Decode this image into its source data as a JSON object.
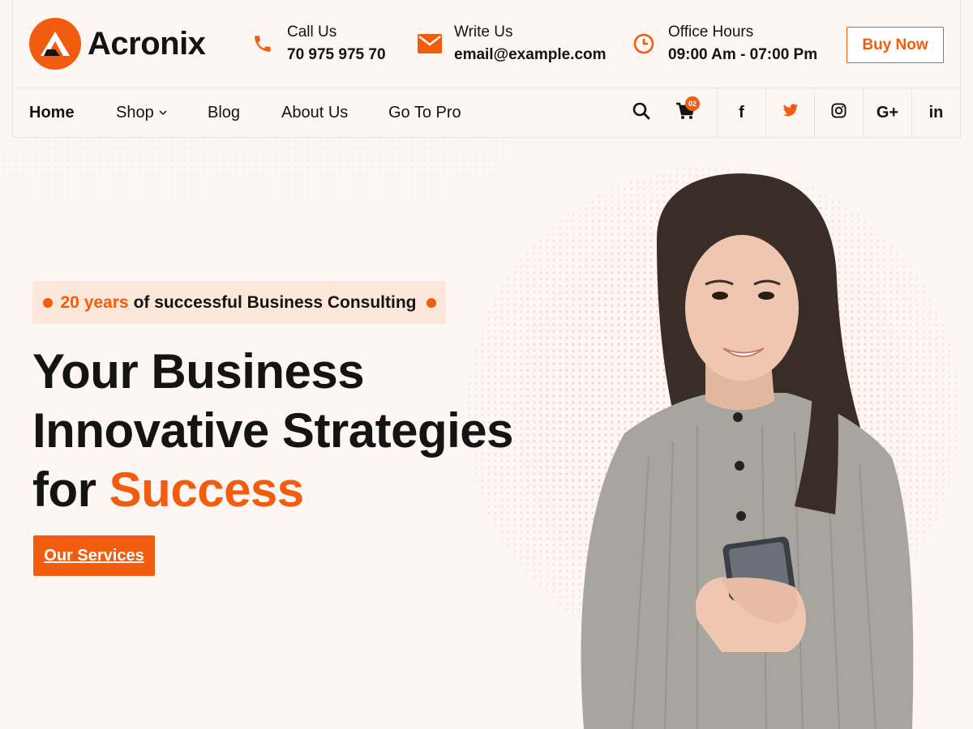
{
  "brand": {
    "name": "Acronix",
    "accent": "#f25c0f"
  },
  "contacts": [
    {
      "icon": "phone-icon",
      "label": "Call Us",
      "value": "70 975 975 70"
    },
    {
      "icon": "envelope-icon",
      "label": "Write Us",
      "value": "email@example.com"
    },
    {
      "icon": "clock-icon",
      "label": "Office Hours",
      "value": "09:00 Am - 07:00 Pm"
    }
  ],
  "header": {
    "buy_label": "Buy Now"
  },
  "nav": {
    "items": [
      {
        "label": "Home",
        "active": true
      },
      {
        "label": "Shop",
        "dropdown": true
      },
      {
        "label": "Blog"
      },
      {
        "label": "About Us"
      },
      {
        "label": "Go To Pro"
      }
    ],
    "cart_count": "02",
    "social": [
      {
        "name": "facebook-icon",
        "glyph": "f"
      },
      {
        "name": "twitter-icon",
        "glyph": ""
      },
      {
        "name": "instagram-icon",
        "glyph": ""
      },
      {
        "name": "google-plus-icon",
        "glyph": "G+"
      },
      {
        "name": "linkedin-icon",
        "glyph": "in"
      }
    ]
  },
  "hero": {
    "badge_highlight": "20 years",
    "badge_text": "of successful Business Consulting",
    "title_line1": "Your Business",
    "title_line2": "Innovative Strategies",
    "title_line3_prefix": "for",
    "title_line3_accent": "Success",
    "cta_label": "Our Services"
  }
}
